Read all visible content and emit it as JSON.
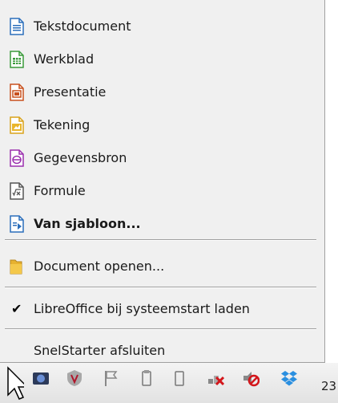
{
  "menu": {
    "items": [
      {
        "label": "Tekstdocument",
        "icon": "writer-document-icon"
      },
      {
        "label": "Werkblad",
        "icon": "calc-spreadsheet-icon"
      },
      {
        "label": "Presentatie",
        "icon": "impress-presentation-icon"
      },
      {
        "label": "Tekening",
        "icon": "draw-drawing-icon"
      },
      {
        "label": "Gegevensbron",
        "icon": "base-database-icon"
      },
      {
        "label": "Formule",
        "icon": "math-formula-icon"
      },
      {
        "label": "Van sjabloon...",
        "icon": "template-icon"
      }
    ],
    "open_document": "Document openen...",
    "load_on_startup": "LibreOffice bij systeemstart laden",
    "load_on_startup_checked": true,
    "quit": "SnelStarter afsluiten"
  },
  "taskbar": {
    "clock_partial": "23",
    "tray_icons": [
      "mouse-cursor-icon",
      "camera-icon",
      "shield-icon",
      "flag-icon",
      "usb-device-icon",
      "network-disconnected-icon",
      "no-sound-icon",
      "dropbox-icon"
    ]
  },
  "colors": {
    "writer": "#2a6ebb",
    "calc": "#3a9a3a",
    "impress": "#c8501e",
    "draw": "#d9a21a",
    "base": "#9b2fae",
    "math": "#555555",
    "template": "#2a6ebb"
  }
}
